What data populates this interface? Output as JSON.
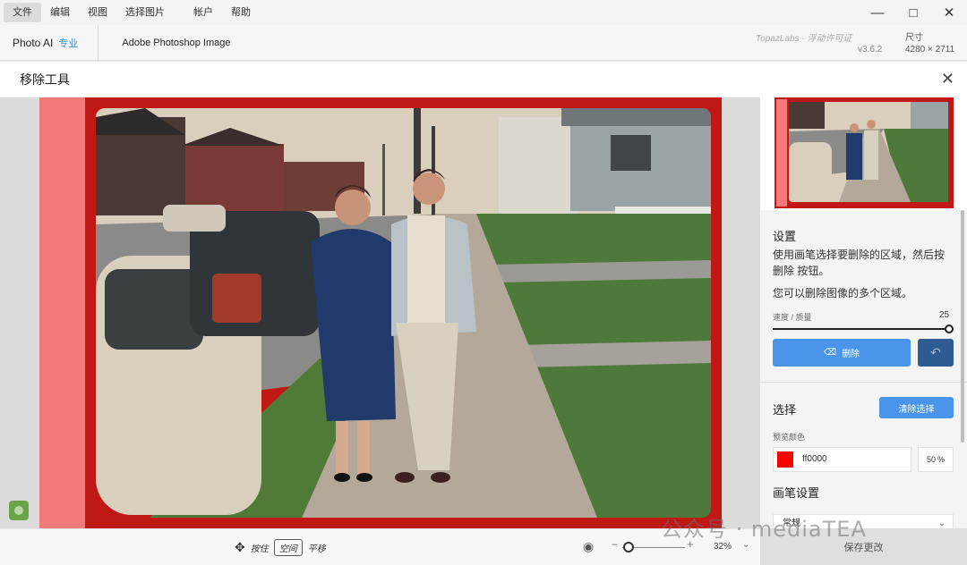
{
  "menu": [
    "文件",
    "编辑",
    "视图",
    "选择图片",
    "帐户",
    "帮助"
  ],
  "app": {
    "name": "Photo AI",
    "tier": "专业",
    "filename": "Adobe Photoshop Image",
    "license": "TopazLabs - 浮动许可证",
    "version": "v3.6.2",
    "size_label": "尺寸",
    "size_value": "4280 × 2711"
  },
  "tool": {
    "title": "移除工具"
  },
  "panel": {
    "settings_title": "设置",
    "desc1": "使用画笔选择要删除的区域，然后按 删除 按钮。",
    "desc2": "您可以删除图像的多个区域。",
    "slider_label": "速度 / 质量",
    "slider_value": "25",
    "slider_fraction": 1.0,
    "erase_label": "删除",
    "selection_title": "选择",
    "clear_label": "清除选择",
    "preview_color_label": "预览颜色",
    "color_value": "ff0000",
    "opacity_value": "50",
    "opacity_unit": "%",
    "brush_title": "画笔设置",
    "brush_mode": "常规"
  },
  "bottom": {
    "hold": "按住",
    "key": "空间",
    "pan": "平移",
    "zoom": "32%",
    "save": "保存更改"
  },
  "watermark": "公众号 · mediaTEA",
  "colors": {
    "accent": "#4a95ea",
    "mask": "#c01814",
    "swatch": "#ff0000"
  }
}
